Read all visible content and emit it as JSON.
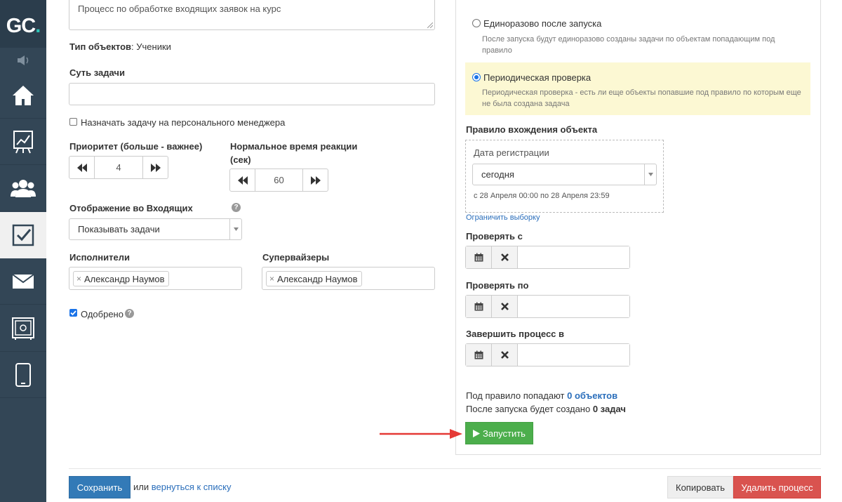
{
  "sidebar": {
    "logo": "GC",
    "logo_dot": ".",
    "items": [
      "home-icon",
      "chart-icon",
      "users-icon",
      "tasks-icon",
      "mail-icon",
      "safe-icon",
      "mobile-icon"
    ]
  },
  "form": {
    "description_value": "Процесс по обработке входящих заявок на курс",
    "object_type_label": "Тип объектов",
    "object_type_value": ": Ученики",
    "task_essence_label": "Суть задачи",
    "task_essence_value": "",
    "assign_personal_label": "Назначать задачу на персонального менеджера",
    "priority_label": "Приоритет (больше - важнее)",
    "priority_value": "4",
    "reaction_label_1": "Нормальное время реакции",
    "reaction_label_2": "(сек)",
    "reaction_value": "60",
    "inbox_label": "Отображение во Входящих",
    "inbox_value": "Показывать задачи",
    "executors_label": "Исполнители",
    "executor_tag": "Александр Наумов",
    "supervisors_label": "Супервайзеры",
    "supervisor_tag": "Александр Наумов",
    "approved_label": "Одобрено",
    "help_glyph": "?"
  },
  "panel": {
    "once_label": "Единоразово после запуска",
    "once_hint_1": "После запуска будут единоразово созданы задачи по объектам попадающим под",
    "once_hint_2": "правило",
    "periodic_label": "Периодическая проверка",
    "periodic_hint_1": "Периодическая проверка - есть ли еще объекты попавшие под правило по которым еще",
    "periodic_hint_2": "не была создана задача",
    "rule_label": "Правило вхождения объекта",
    "reg_date_label": "Дата регистрации",
    "reg_date_value": "сегодня",
    "reg_range": "с 28 Апреля 00:00 по 28 Апреля 23:59",
    "limit_link": "Ограничить выборку",
    "check_from_label": "Проверять с",
    "check_to_label": "Проверять по",
    "finish_label": "Завершить процесс в",
    "summary_prefix_1": "Под правило попадают ",
    "summary_count_1": "0 объектов",
    "summary_prefix_2": "После запуска будет создано ",
    "summary_count_2": "0 задач",
    "run_button": "Запустить"
  },
  "footer": {
    "save_button": "Сохранить",
    "or_text": "или",
    "back_link": "вернуться к списку",
    "copy_button": "Копировать",
    "delete_button": "Удалить процесс"
  },
  "colors": {
    "sidebar": "#334656",
    "accent_blue": "#337ab7",
    "green": "#4cae4c",
    "red": "#d9534f",
    "highlight": "#fcf8d3",
    "arrow": "#e53935"
  }
}
